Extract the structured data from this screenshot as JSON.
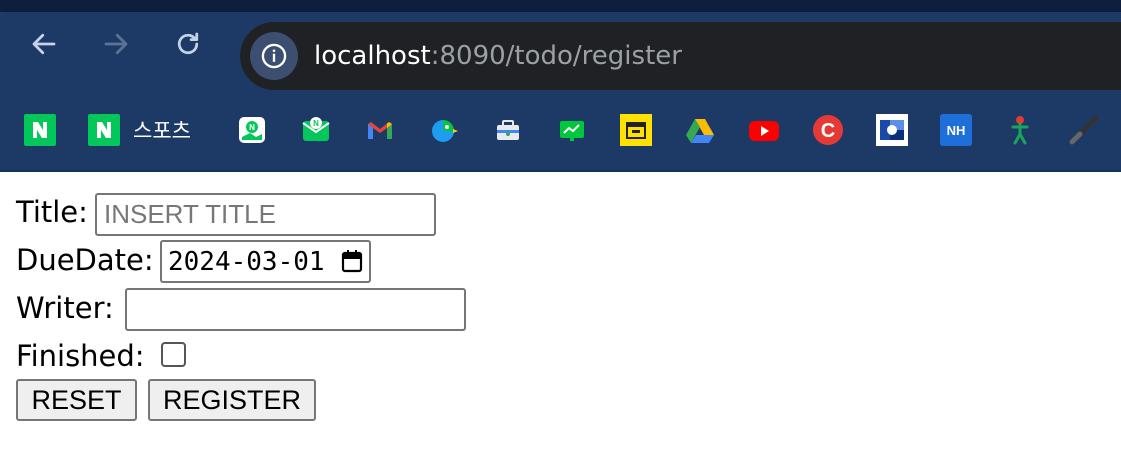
{
  "browser": {
    "url_host": "localhost",
    "url_rest": ":8090/todo/register"
  },
  "bookmarks": [
    {
      "icon": "naver-icon",
      "label": ""
    },
    {
      "icon": "naver-icon",
      "label": "스포츠"
    },
    {
      "icon": "naver-map-icon",
      "label": ""
    },
    {
      "icon": "naver-mail-icon",
      "label": ""
    },
    {
      "icon": "gmail-icon",
      "label": ""
    },
    {
      "icon": "papago-icon",
      "label": ""
    },
    {
      "icon": "toolbox-icon",
      "label": ""
    },
    {
      "icon": "green-board-icon",
      "label": ""
    },
    {
      "icon": "yellow-box-icon",
      "label": ""
    },
    {
      "icon": "google-drive-icon",
      "label": ""
    },
    {
      "icon": "youtube-icon",
      "label": ""
    },
    {
      "icon": "red-c-icon",
      "label": ""
    },
    {
      "icon": "blue-logo-icon",
      "label": ""
    },
    {
      "icon": "nh-icon",
      "label": ""
    },
    {
      "icon": "figure-icon",
      "label": ""
    },
    {
      "icon": "dark-slash-icon",
      "label": ""
    }
  ],
  "form": {
    "title_label": "Title:",
    "title_placeholder": "INSERT TITLE",
    "title_value": "",
    "duedate_label": "DueDate:",
    "duedate_value": "2024-03-01",
    "writer_label": "Writer:",
    "writer_value": "",
    "finished_label": "Finished:",
    "finished_checked": false,
    "reset_label": "RESET",
    "register_label": "REGISTER"
  }
}
